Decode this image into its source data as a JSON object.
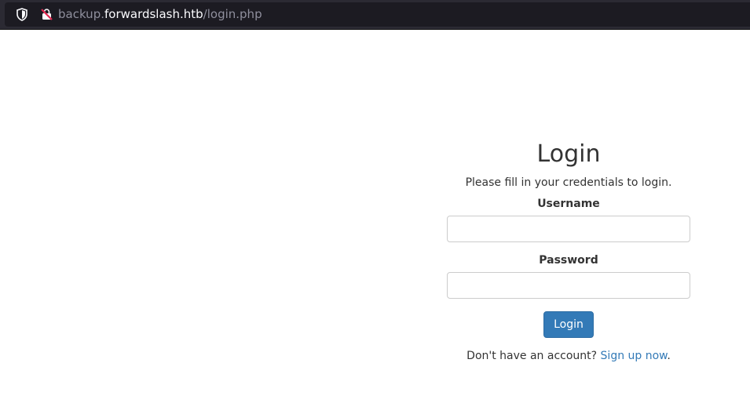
{
  "browser": {
    "url_prefix": "backup.",
    "url_host": "forwardslash.htb",
    "url_path": "/login.php"
  },
  "login": {
    "title": "Login",
    "subtitle": "Please fill in your credentials to login.",
    "username_label": "Username",
    "username_value": "",
    "password_label": "Password",
    "password_value": "",
    "submit_label": "Login",
    "signup_prompt": "Don't have an account? ",
    "signup_link": "Sign up now",
    "signup_suffix": "."
  },
  "colors": {
    "primary": "#337ab7",
    "text": "#333333",
    "input_border": "#cccccc",
    "urlbar_bg": "#2b2a33"
  }
}
